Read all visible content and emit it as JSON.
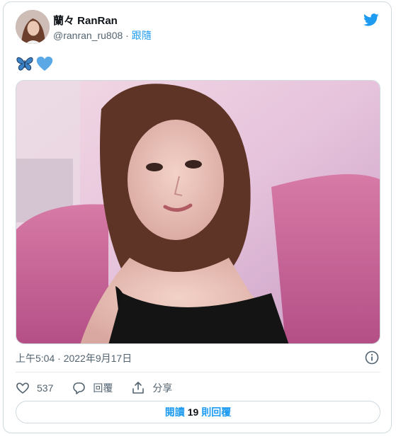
{
  "tweet": {
    "author_name": "蘭々 RanRan",
    "handle": "@ranran_ru808",
    "separator": "·",
    "follow_label": "跟隨",
    "emoji_text": [
      "butterfly-emoji",
      "blue-heart-emoji"
    ],
    "timestamp": "上午5:04 · 2022年9月17日",
    "likes_count": "537",
    "reply_label": "回覆",
    "share_label": "分享",
    "replies_button": {
      "prefix": "閱讀",
      "count": "19",
      "suffix": "則回覆"
    }
  },
  "colors": {
    "accent": "#1d9bf0",
    "secondary_text": "#536471",
    "border": "#cfd9de"
  },
  "icons": {
    "brand": "twitter-bird-icon",
    "info": "info-icon",
    "like": "heart-icon",
    "reply": "reply-bubble-icon",
    "share": "share-icon"
  }
}
